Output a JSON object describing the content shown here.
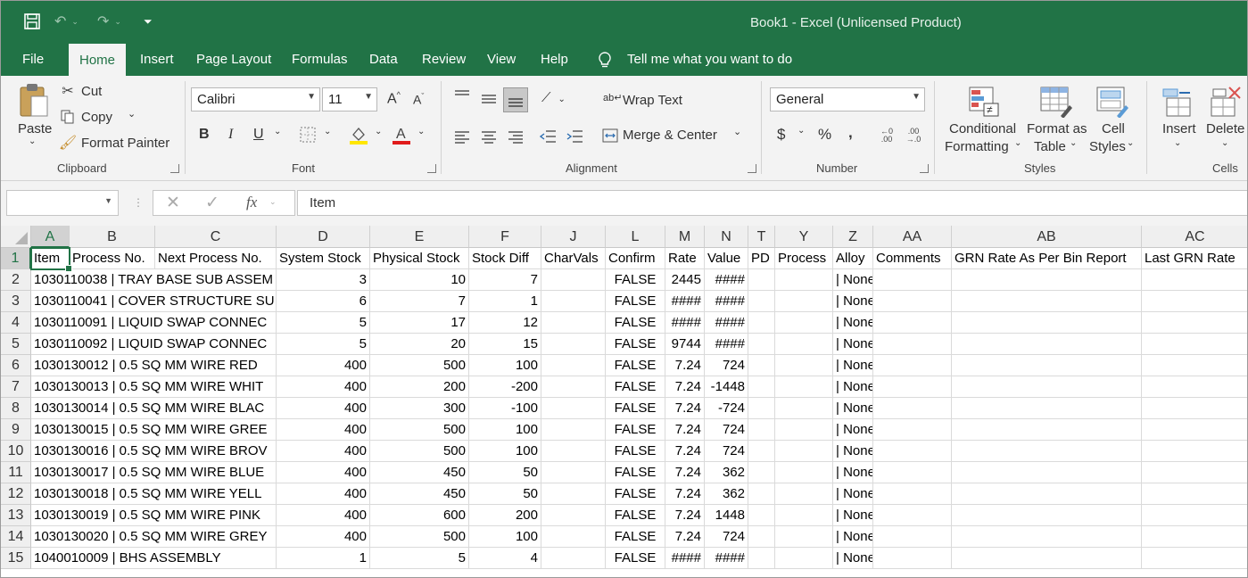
{
  "window": {
    "title": "Book1  -  Excel (Unlicensed Product)"
  },
  "menu": {
    "tabs": [
      "File",
      "Home",
      "Insert",
      "Page Layout",
      "Formulas",
      "Data",
      "Review",
      "View",
      "Help"
    ],
    "active": "Home",
    "tell_me": "Tell me what you want to do"
  },
  "ribbon": {
    "clipboard": {
      "label": "Clipboard",
      "paste": "Paste",
      "cut": "Cut",
      "copy": "Copy",
      "format_painter": "Format Painter"
    },
    "font": {
      "label": "Font",
      "name": "Calibri",
      "size": "11",
      "bold": "B",
      "italic": "I",
      "underline": "U"
    },
    "alignment": {
      "label": "Alignment",
      "wrap_text": "Wrap Text",
      "merge_center": "Merge & Center"
    },
    "number": {
      "label": "Number",
      "format": "General",
      "currency": "$",
      "percent": "%",
      "comma": ","
    },
    "styles": {
      "label": "Styles",
      "conditional_1": "Conditional",
      "conditional_2": "Formatting",
      "format_table_1": "Format as",
      "format_table_2": "Table",
      "cell_styles_1": "Cell",
      "cell_styles_2": "Styles"
    },
    "cells": {
      "label": "Cells",
      "insert": "Insert",
      "delete": "Delete"
    }
  },
  "formula_bar": {
    "name_box": "",
    "content": "Item"
  },
  "sheet": {
    "columns": [
      "A",
      "B",
      "C",
      "D",
      "E",
      "F",
      "J",
      "L",
      "M",
      "N",
      "T",
      "Y",
      "Z",
      "AA",
      "AB",
      "AC"
    ],
    "row_numbers": [
      "1",
      "2",
      "3",
      "4",
      "5",
      "6",
      "7",
      "8",
      "9",
      "10",
      "11",
      "12",
      "13",
      "14",
      "15"
    ],
    "headers": [
      "Item",
      "Process No.",
      "Next Process No.",
      "System Stock",
      "Physical Stock",
      "Stock Diff",
      "CharVals",
      "Confirm",
      "Rate",
      "Value",
      "PD",
      "Process",
      "Alloy",
      "Comments",
      "GRN Rate As Per Bin Report",
      "Last GRN Rate"
    ],
    "rows": [
      {
        "a": "1030110038 | TRAY BASE SUB ASSEM",
        "d": "3",
        "e": "10",
        "f": "7",
        "l": "FALSE",
        "m": "2445",
        "n": "####",
        "z": "| None"
      },
      {
        "a": "1030110041 | COVER STRUCTURE SU",
        "d": "6",
        "e": "7",
        "f": "1",
        "l": "FALSE",
        "m": "####",
        "n": "####",
        "z": "| None"
      },
      {
        "a": "1030110091 | LIQUID SWAP CONNEC",
        "d": "5",
        "e": "17",
        "f": "12",
        "l": "FALSE",
        "m": "####",
        "n": "####",
        "z": "| None"
      },
      {
        "a": "1030110092 | LIQUID SWAP CONNEC",
        "d": "5",
        "e": "20",
        "f": "15",
        "l": "FALSE",
        "m": "9744",
        "n": "####",
        "z": "| None"
      },
      {
        "a": "1030130012 | 0.5 SQ MM WIRE RED",
        "d": "400",
        "e": "500",
        "f": "100",
        "l": "FALSE",
        "m": "7.24",
        "n": "724",
        "z": "| None"
      },
      {
        "a": "1030130013 | 0.5 SQ MM WIRE WHIT",
        "d": "400",
        "e": "200",
        "f": "-200",
        "l": "FALSE",
        "m": "7.24",
        "n": "-1448",
        "z": "| None"
      },
      {
        "a": "1030130014 | 0.5 SQ MM WIRE BLAC",
        "d": "400",
        "e": "300",
        "f": "-100",
        "l": "FALSE",
        "m": "7.24",
        "n": "-724",
        "z": "| None"
      },
      {
        "a": "1030130015 | 0.5 SQ MM WIRE GREE",
        "d": "400",
        "e": "500",
        "f": "100",
        "l": "FALSE",
        "m": "7.24",
        "n": "724",
        "z": "| None"
      },
      {
        "a": "1030130016 | 0.5 SQ MM WIRE BROV",
        "d": "400",
        "e": "500",
        "f": "100",
        "l": "FALSE",
        "m": "7.24",
        "n": "724",
        "z": "| None"
      },
      {
        "a": "1030130017 | 0.5 SQ MM WIRE BLUE",
        "d": "400",
        "e": "450",
        "f": "50",
        "l": "FALSE",
        "m": "7.24",
        "n": "362",
        "z": "| None"
      },
      {
        "a": "1030130018 | 0.5 SQ MM WIRE YELL",
        "d": "400",
        "e": "450",
        "f": "50",
        "l": "FALSE",
        "m": "7.24",
        "n": "362",
        "z": "| None"
      },
      {
        "a": "1030130019 | 0.5 SQ MM WIRE PINK",
        "d": "400",
        "e": "600",
        "f": "200",
        "l": "FALSE",
        "m": "7.24",
        "n": "1448",
        "z": "| None"
      },
      {
        "a": "1030130020 | 0.5 SQ MM WIRE GREY",
        "d": "400",
        "e": "500",
        "f": "100",
        "l": "FALSE",
        "m": "7.24",
        "n": "724",
        "z": "| None"
      },
      {
        "a": "1040010009 | BHS ASSEMBLY",
        "d": "1",
        "e": "5",
        "f": "4",
        "l": "FALSE",
        "m": "####",
        "n": "####",
        "z": "| None"
      }
    ]
  },
  "colors": {
    "brand": "#217346",
    "ribbon": "#f3f3f3"
  }
}
